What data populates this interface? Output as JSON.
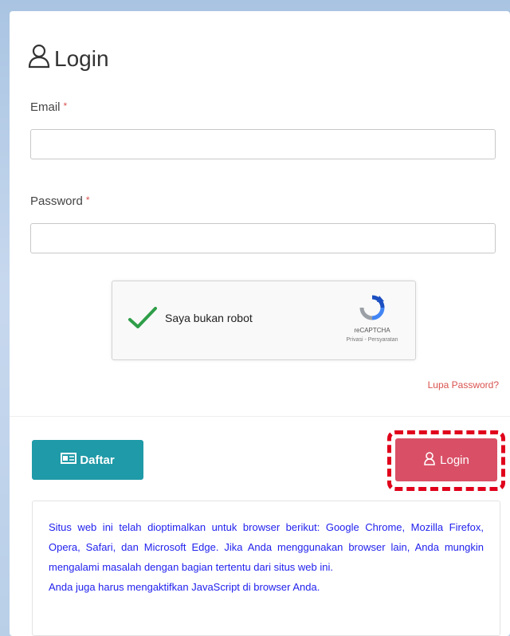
{
  "login_form": {
    "title": "Login",
    "email_label": "Email",
    "email_value": "",
    "password_label": "Password",
    "password_value": "",
    "required_mark": "*",
    "captcha": {
      "label": "Saya bukan robot",
      "brand": "reCAPTCHA",
      "terms": "Privasi - Persyaratan",
      "checked": true
    },
    "forgot_password": "Lupa Password?",
    "register_button": "Daftar",
    "login_button": "Login"
  },
  "notice": {
    "paragraph1": "Situs web ini telah dioptimalkan untuk browser berikut: Google Chrome, Mozilla Firefox, Opera, Safari, dan Microsoft Edge. Jika Anda menggunakan browser lain, Anda mungkin mengalami masalah dengan bagian tertentu dari situs web ini.",
    "paragraph2": "Anda juga harus mengaktifkan JavaScript di browser Anda."
  },
  "colors": {
    "register_button": "#1f9aa8",
    "login_button": "#d95066",
    "highlight_outline": "#e0001b",
    "notice_text": "#2222ee",
    "required": "#d9534f"
  },
  "icons": [
    "user-icon",
    "checkmark-icon",
    "recaptcha-logo-icon",
    "register-card-icon",
    "login-user-icon"
  ]
}
